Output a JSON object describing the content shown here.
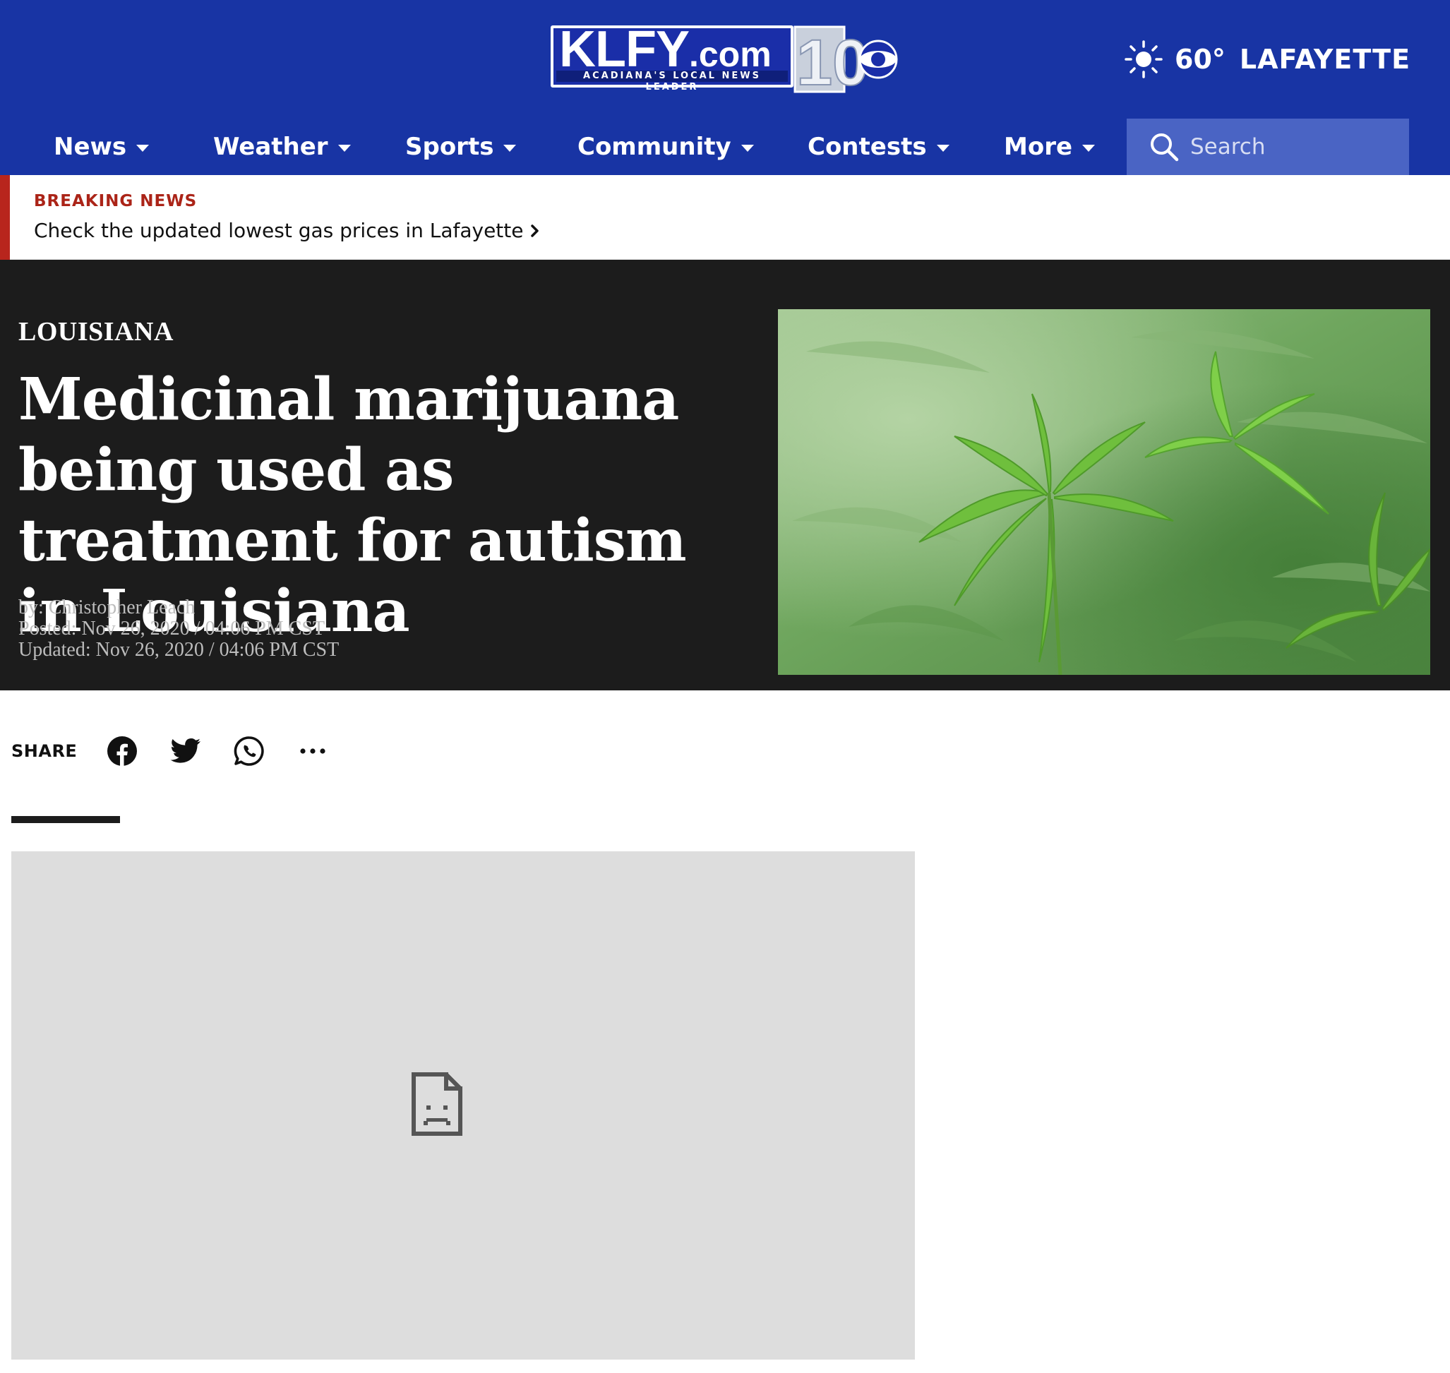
{
  "brand": {
    "name": "KLFY",
    "domain_suffix": ".com",
    "tagline": "ACADIANA'S LOCAL NEWS LEADER",
    "channel_number": "10"
  },
  "weather": {
    "temperature": "60°",
    "location": "LAFAYETTE",
    "icon": "sun-icon"
  },
  "nav": {
    "items": [
      {
        "label": "News"
      },
      {
        "label": "Weather"
      },
      {
        "label": "Sports"
      },
      {
        "label": "Community"
      },
      {
        "label": "Contests"
      },
      {
        "label": "More"
      }
    ],
    "search_placeholder": "Search"
  },
  "breaking": {
    "label": "BREAKING NEWS",
    "headline": "Check the updated lowest gas prices in Lafayette"
  },
  "article": {
    "section": "LOUISIANA",
    "title": "Medicinal marijuana being used as treatment for autism in Louisiana",
    "byline": "by: Christopher Leach",
    "posted": "Posted: Nov 26, 2020 / 04:06 PM CST",
    "updated": "Updated: Nov 26, 2020 / 04:06 PM CST"
  },
  "share": {
    "label": "SHARE",
    "icons": [
      "facebook-icon",
      "twitter-icon",
      "whatsapp-icon",
      "more-options-icon"
    ]
  },
  "colors": {
    "header_bg": "#1834a4",
    "search_bg": "#4a64c4",
    "breaking_accent": "#b8251d",
    "hero_bg": "#1c1c1c",
    "video_placeholder_bg": "#dddddd"
  }
}
